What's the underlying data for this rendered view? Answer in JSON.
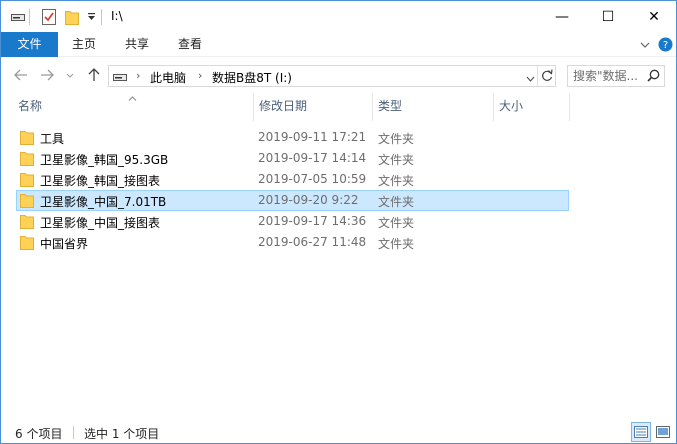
{
  "window": {
    "title": "I:\\",
    "minimize": "—",
    "maximize": "☐",
    "close": "✕"
  },
  "ribbon": {
    "tabs": [
      {
        "label": "文件"
      },
      {
        "label": "主页"
      },
      {
        "label": "共享"
      },
      {
        "label": "查看"
      }
    ]
  },
  "address": {
    "breadcrumb": [
      "此电脑",
      "数据B盘8T (I:)"
    ]
  },
  "search": {
    "placeholder": "搜索\"数据..."
  },
  "columns": {
    "name": "名称",
    "date": "修改日期",
    "type": "类型",
    "size": "大小"
  },
  "files": [
    {
      "name": "工具",
      "date": "2019-09-11 17:21",
      "type": "文件夹",
      "selected": false
    },
    {
      "name": "卫星影像_韩国_95.3GB",
      "date": "2019-09-17 14:14",
      "type": "文件夹",
      "selected": false
    },
    {
      "name": "卫星影像_韩国_接图表",
      "date": "2019-07-05 10:59",
      "type": "文件夹",
      "selected": false
    },
    {
      "name": "卫星影像_中国_7.01TB",
      "date": "2019-09-20 9:22",
      "type": "文件夹",
      "selected": true
    },
    {
      "name": "卫星影像_中国_接图表",
      "date": "2019-09-17 14:36",
      "type": "文件夹",
      "selected": false
    },
    {
      "name": "中国省界",
      "date": "2019-06-27 11:48",
      "type": "文件夹",
      "selected": false
    }
  ],
  "status": {
    "item_count": "6 个项目",
    "selected_count": "选中 1 个项目"
  },
  "colors": {
    "accent": "#1979ca",
    "selection_bg": "#cce8ff",
    "selection_border": "#99d1ff",
    "folder": "#ffd257"
  }
}
